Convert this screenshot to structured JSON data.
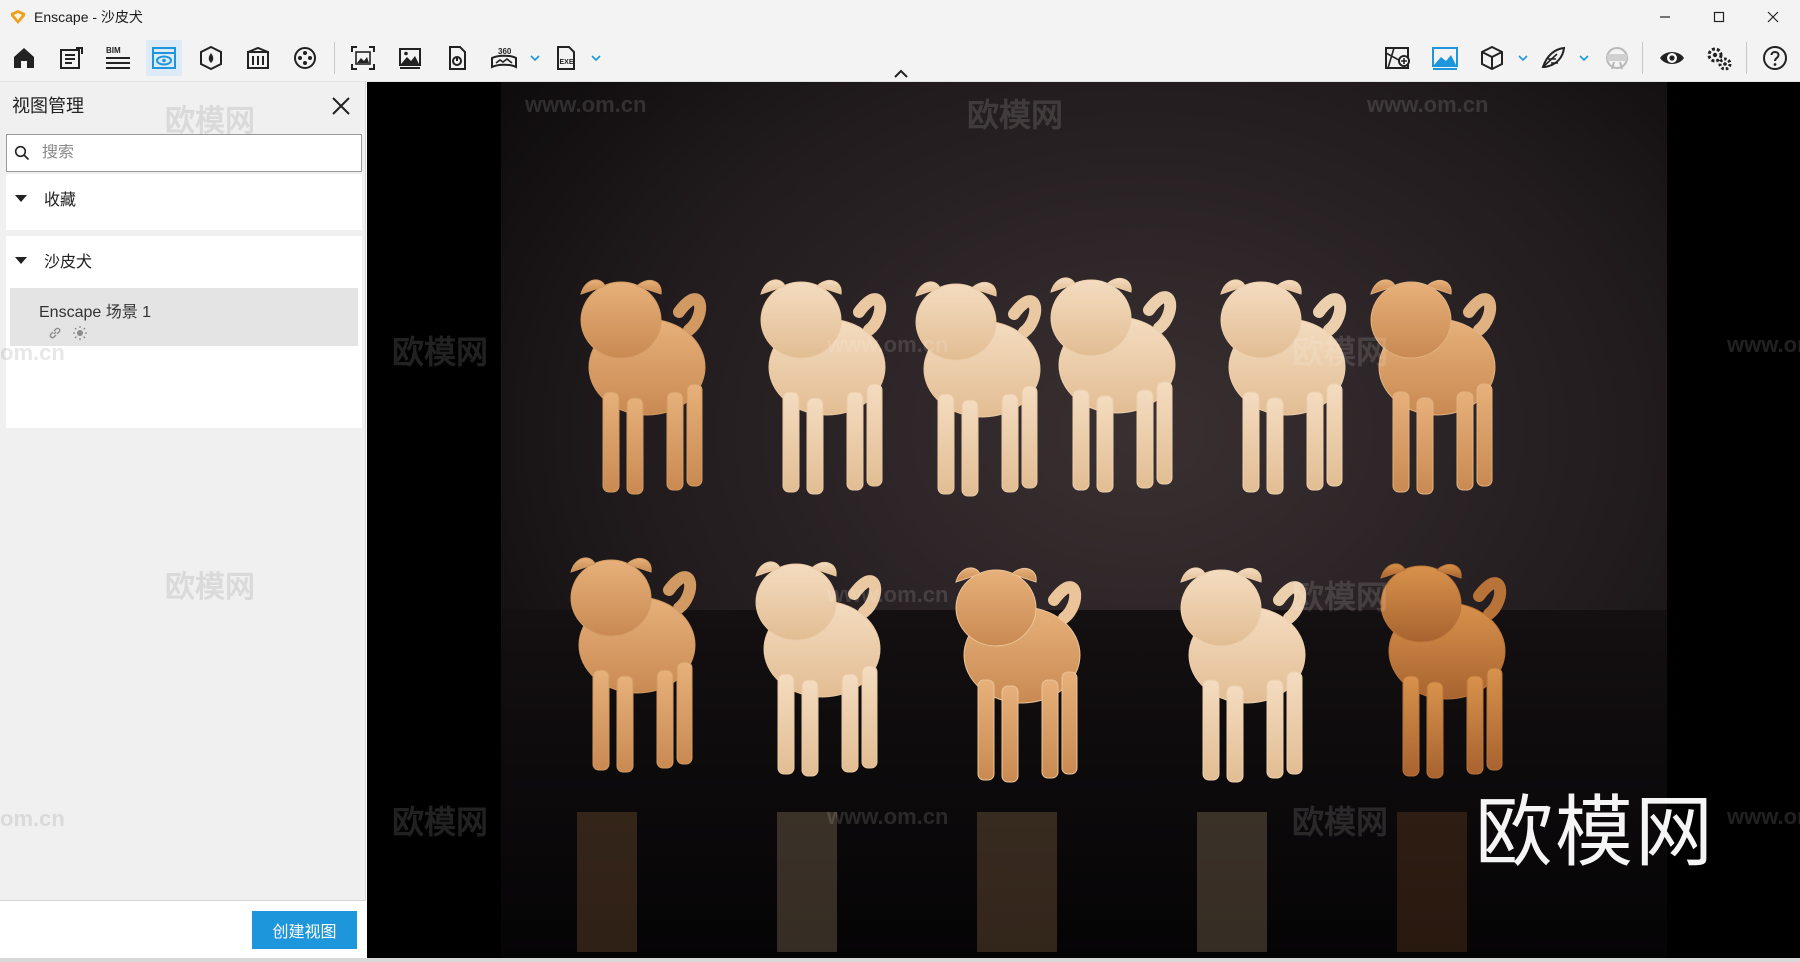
{
  "window": {
    "title": "Enscape - 沙皮犬",
    "brand_color": "#f0a020"
  },
  "toolbar": {
    "left_icons": [
      "home-icon",
      "notes-icon",
      "bim-icon",
      "view-management-icon",
      "vr-asset-icon",
      "building-icon",
      "video-reel-icon",
      "screenshot-icon",
      "image-icon",
      "batch-render-icon",
      "panorama-360-icon",
      "exe-export-icon"
    ],
    "right_icons": [
      "map-icon",
      "sky-image-icon",
      "cube-icon",
      "feather-icon",
      "vr-headset-icon",
      "eye-icon",
      "settings-icon",
      "help-icon"
    ],
    "bim_label": "BIM",
    "pano_label": "360",
    "exe_label": "EXE",
    "accent_color": "#1e96dc"
  },
  "sidebar": {
    "title": "视图管理",
    "search_placeholder": "搜索",
    "favorites_label": "收藏",
    "group_label": "沙皮犬",
    "view_item_name": "Enscape 场景 1",
    "create_view_label": "创建视图"
  },
  "viewport": {
    "brand_watermark": "欧模网",
    "watermark_url": "www.om.cn",
    "watermark_brand": "欧模网",
    "watermark_fragment": "om.cn",
    "dog_count_top": 6,
    "dog_count_bottom": 5
  }
}
